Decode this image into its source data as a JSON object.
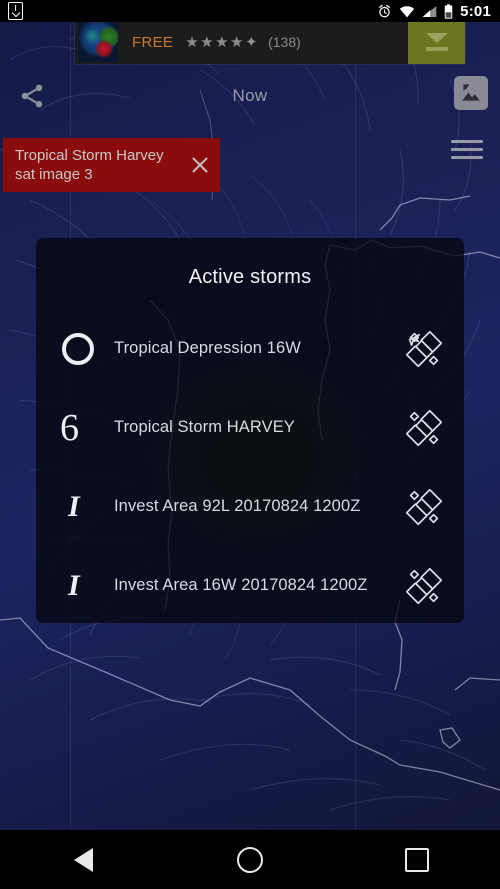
{
  "status_bar": {
    "download_icon": "download-badge-icon",
    "alarm_icon": "alarm-clock-icon",
    "wifi_icon": "wifi-icon",
    "signal_icon": "cell-signal-icon",
    "battery_icon": "battery-icon",
    "time": "5:01"
  },
  "ad_banner": {
    "app_icon": "earth-globe-app-icon",
    "price_label": "FREE",
    "stars": "★★★★✦",
    "rating_count": "(138)",
    "cta_icon": "download-arrow-icon"
  },
  "toolbar": {
    "share_icon": "share-icon",
    "time_label": "Now",
    "image_layer_icon": "image-icon",
    "menu_icon": "hamburger-menu-icon"
  },
  "chip": {
    "label": "Tropical Storm Harvey sat image 3",
    "close_icon": "close-icon",
    "background_color": "#8a0c0c"
  },
  "dialog": {
    "title": "Active storms",
    "storms": [
      {
        "symbol": "tropical-depression-circle-symbol",
        "name": "Tropical Depression 16W",
        "action_icon": "satellite-icon"
      },
      {
        "symbol": "tropical-storm-cyclone-symbol",
        "symbol_glyph": "6",
        "name": "Tropical Storm HARVEY",
        "action_icon": "satellite-icon"
      },
      {
        "symbol": "invest-area-symbol",
        "symbol_glyph": "I",
        "name": "Invest Area 92L 20170824 1200Z",
        "action_icon": "satellite-icon"
      },
      {
        "symbol": "invest-area-symbol",
        "symbol_glyph": "I",
        "name": "Invest Area 16W 20170824 1200Z",
        "action_icon": "satellite-icon"
      }
    ]
  },
  "nav_bar": {
    "back_icon": "back-triangle-icon",
    "home_icon": "home-circle-icon",
    "recents_icon": "recents-square-icon"
  }
}
